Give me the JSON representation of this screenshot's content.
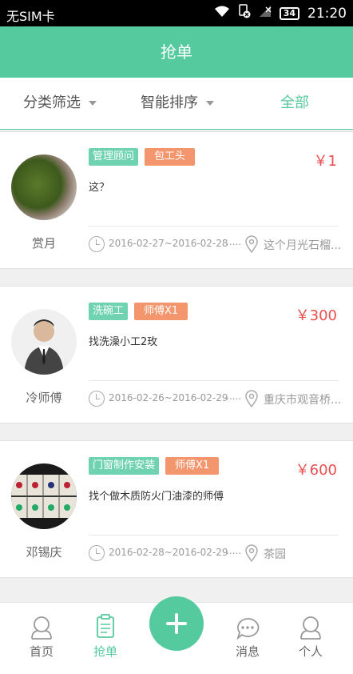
{
  "status": {
    "carrier": "无SIM卡",
    "time": "21:20",
    "battery": "34"
  },
  "header": {
    "title": "抢单"
  },
  "filters": {
    "category": "分类筛选",
    "sort": "智能排序",
    "all": "全部"
  },
  "orders": [
    {
      "user": "赏月",
      "tags": [
        "管理顾问",
        "包工头"
      ],
      "price": "￥1",
      "desc": "这？",
      "dates": "2016-02-27~2016-02-28",
      "dots": ".....",
      "address": "这个月光石榴..."
    },
    {
      "user": "冷师傅",
      "tags": [
        "洗碗工",
        "师傅X1"
      ],
      "price": "￥300",
      "desc": "找洗澡小工2玫",
      "dates": "2016-02-26~2016-02-29",
      "dots": ".....",
      "address": "重庆市观音桥..."
    },
    {
      "user": "邓锡庆",
      "tags": [
        "门窗制作安装",
        "师傅X1"
      ],
      "price": "￥600",
      "desc": "找个做木质防火门油漆的师傅",
      "dates": "2016-02-28~2016-02-29",
      "dots": ".....",
      "address": "茶园"
    }
  ],
  "tabs": {
    "home": "首页",
    "orders": "抢单",
    "messages": "消息",
    "profile": "个人"
  },
  "colors": {
    "accent": "#55ca9f",
    "price": "#e94f4f",
    "tag_green": "#6fd2b0",
    "tag_orange": "#f4966d"
  }
}
